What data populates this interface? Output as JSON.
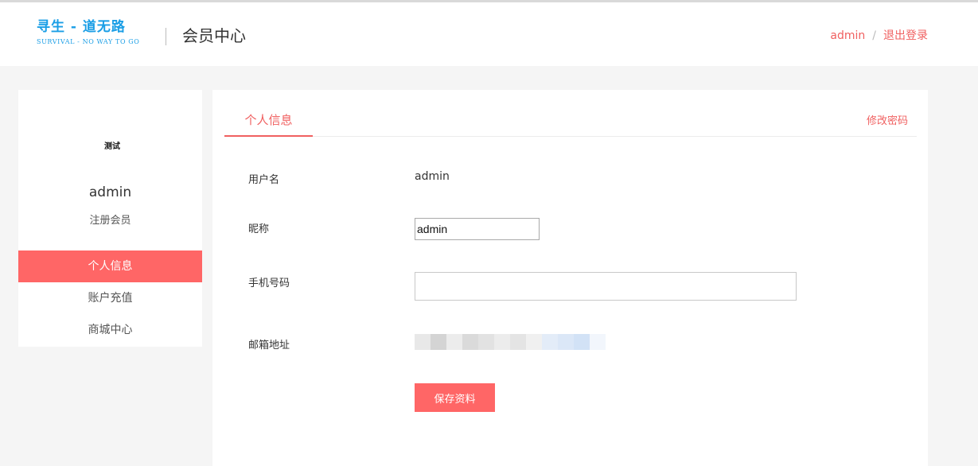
{
  "header": {
    "logo_cn": "寻生 - 道无路",
    "logo_en": "SURVIVAL - NO WAY TO GO",
    "title": "会员中心",
    "user_link": "admin",
    "separator": "/",
    "logout_link": "退出登录"
  },
  "sidebar": {
    "avatar_text": "测试",
    "username": "admin",
    "role": "注册会员",
    "items": [
      {
        "label": "个人信息",
        "active": true
      },
      {
        "label": "账户充值",
        "active": false
      },
      {
        "label": "商城中心",
        "active": false
      }
    ]
  },
  "tabs": {
    "active": "个人信息",
    "right_link": "修改密码"
  },
  "form": {
    "username_label": "用户名",
    "username_value": "admin",
    "nickname_label": "昵称",
    "nickname_value": "admin",
    "phone_label": "手机号码",
    "phone_value": "",
    "email_label": "邮箱地址",
    "save_label": "保存资料"
  },
  "colors": {
    "accent": "#ff6666",
    "link": "#f06060",
    "logo": "#1a9ee6"
  }
}
